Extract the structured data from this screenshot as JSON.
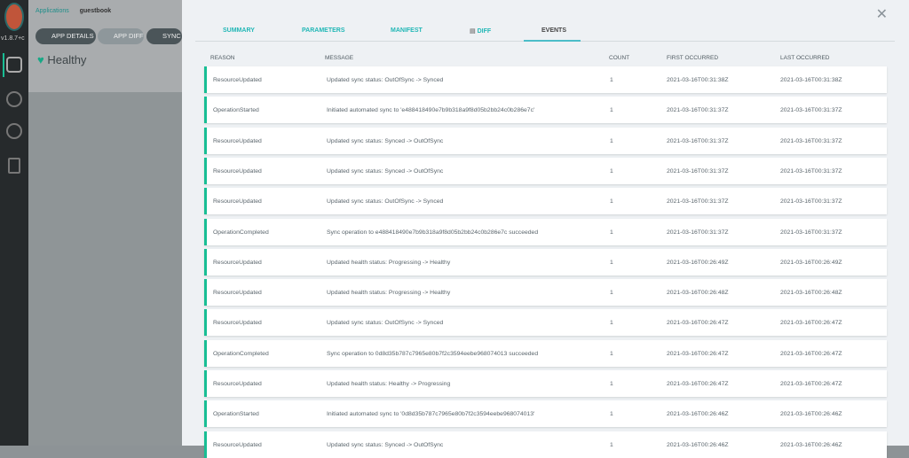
{
  "sidebar": {
    "version": "v1.8.7+c",
    "items": [
      "applications-icon",
      "settings-icon",
      "user-icon",
      "docs-icon"
    ]
  },
  "breadcrumb": {
    "root": "Applications",
    "current": "guestbook"
  },
  "buttons": {
    "details": "APP DETAILS",
    "diff": "APP DIFF",
    "sync": "SYNC"
  },
  "health": {
    "status": "Healthy",
    "color": "#18be94"
  },
  "tabs": [
    "SUMMARY",
    "PARAMETERS",
    "MANIFEST",
    "DIFF",
    "EVENTS"
  ],
  "active_tab": "EVENTS",
  "columns": {
    "reason": "REASON",
    "message": "MESSAGE",
    "count": "COUNT",
    "first": "FIRST OCCURRED",
    "last": "LAST OCCURRED"
  },
  "events": [
    {
      "reason": "ResourceUpdated",
      "message": "Updated sync status: OutOfSync -> Synced",
      "count": "1",
      "first": "2021-03-16T00:31:38Z",
      "last": "2021-03-16T00:31:38Z"
    },
    {
      "reason": "OperationStarted",
      "message": "Initiated automated sync to 'e488418490e7b9b318a9f8d05b2bb24c0b286e7c'",
      "count": "1",
      "first": "2021-03-16T00:31:37Z",
      "last": "2021-03-16T00:31:37Z"
    },
    {
      "reason": "ResourceUpdated",
      "message": "Updated sync status: Synced -> OutOfSync",
      "count": "1",
      "first": "2021-03-16T00:31:37Z",
      "last": "2021-03-16T00:31:37Z"
    },
    {
      "reason": "ResourceUpdated",
      "message": "Updated sync status: Synced -> OutOfSync",
      "count": "1",
      "first": "2021-03-16T00:31:37Z",
      "last": "2021-03-16T00:31:37Z"
    },
    {
      "reason": "ResourceUpdated",
      "message": "Updated sync status: OutOfSync -> Synced",
      "count": "1",
      "first": "2021-03-16T00:31:37Z",
      "last": "2021-03-16T00:31:37Z"
    },
    {
      "reason": "OperationCompleted",
      "message": "Sync operation to e488418490e7b9b318a9f8d05b2bb24c0b286e7c succeeded",
      "count": "1",
      "first": "2021-03-16T00:31:37Z",
      "last": "2021-03-16T00:31:37Z"
    },
    {
      "reason": "ResourceUpdated",
      "message": "Updated health status: Progressing -> Healthy",
      "count": "1",
      "first": "2021-03-16T00:26:49Z",
      "last": "2021-03-16T00:26:49Z"
    },
    {
      "reason": "ResourceUpdated",
      "message": "Updated health status: Progressing -> Healthy",
      "count": "1",
      "first": "2021-03-16T00:26:48Z",
      "last": "2021-03-16T00:26:48Z"
    },
    {
      "reason": "ResourceUpdated",
      "message": "Updated sync status: OutOfSync -> Synced",
      "count": "1",
      "first": "2021-03-16T00:26:47Z",
      "last": "2021-03-16T00:26:47Z"
    },
    {
      "reason": "OperationCompleted",
      "message": "Sync operation to 0d8d35b787c7965e80b7f2c3594eebe968074013 succeeded",
      "count": "1",
      "first": "2021-03-16T00:26:47Z",
      "last": "2021-03-16T00:26:47Z"
    },
    {
      "reason": "ResourceUpdated",
      "message": "Updated health status: Healthy -> Progressing",
      "count": "1",
      "first": "2021-03-16T00:26:47Z",
      "last": "2021-03-16T00:26:47Z"
    },
    {
      "reason": "OperationStarted",
      "message": "Initiated automated sync to '0d8d35b787c7965e80b7f2c3594eebe968074013'",
      "count": "1",
      "first": "2021-03-16T00:26:46Z",
      "last": "2021-03-16T00:26:46Z"
    },
    {
      "reason": "ResourceUpdated",
      "message": "Updated sync status: Synced -> OutOfSync",
      "count": "1",
      "first": "2021-03-16T00:26:46Z",
      "last": "2021-03-16T00:26:46Z"
    }
  ]
}
